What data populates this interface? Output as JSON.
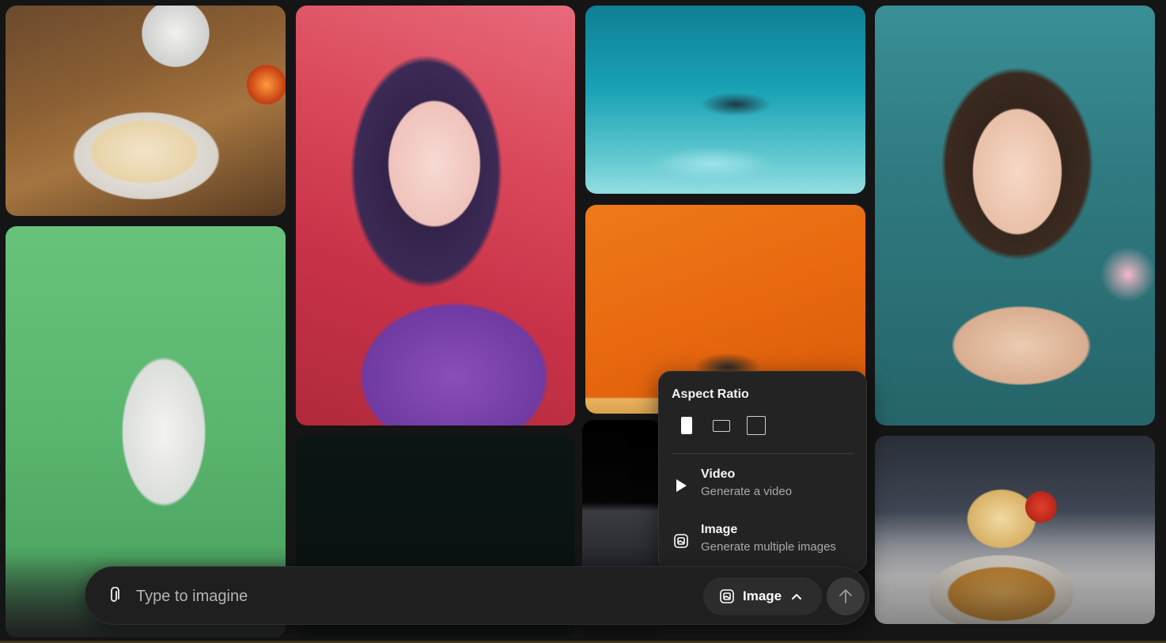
{
  "gallery": {
    "tiles": [
      {
        "name": "pancakes-image"
      },
      {
        "name": "anime-kimono-image"
      },
      {
        "name": "underwater-room-image"
      },
      {
        "name": "orange-wall-image"
      },
      {
        "name": "underwater-portrait-image"
      },
      {
        "name": "origami-rabbit-image"
      },
      {
        "name": "dark-image"
      },
      {
        "name": "dark-shore-image"
      },
      {
        "name": "waffle-image"
      }
    ]
  },
  "popup": {
    "title": "Aspect Ratio",
    "ratios": [
      {
        "name": "portrait",
        "selected": true
      },
      {
        "name": "landscape",
        "selected": false
      },
      {
        "name": "square",
        "selected": false
      }
    ],
    "items": [
      {
        "icon": "play-icon",
        "label": "Video",
        "description": "Generate a video"
      },
      {
        "icon": "image-icon",
        "label": "Image",
        "description": "Generate multiple images"
      }
    ]
  },
  "prompt": {
    "placeholder": "Type to imagine",
    "attach_icon": "paperclip-icon",
    "mode_icon": "image-icon",
    "mode_label": "Image",
    "mode_chevron": "chevron-up-icon",
    "send_icon": "arrow-up-icon"
  },
  "colors": {
    "background": "#151515",
    "panel": "#232323",
    "text_secondary": "#a9a9a9"
  }
}
